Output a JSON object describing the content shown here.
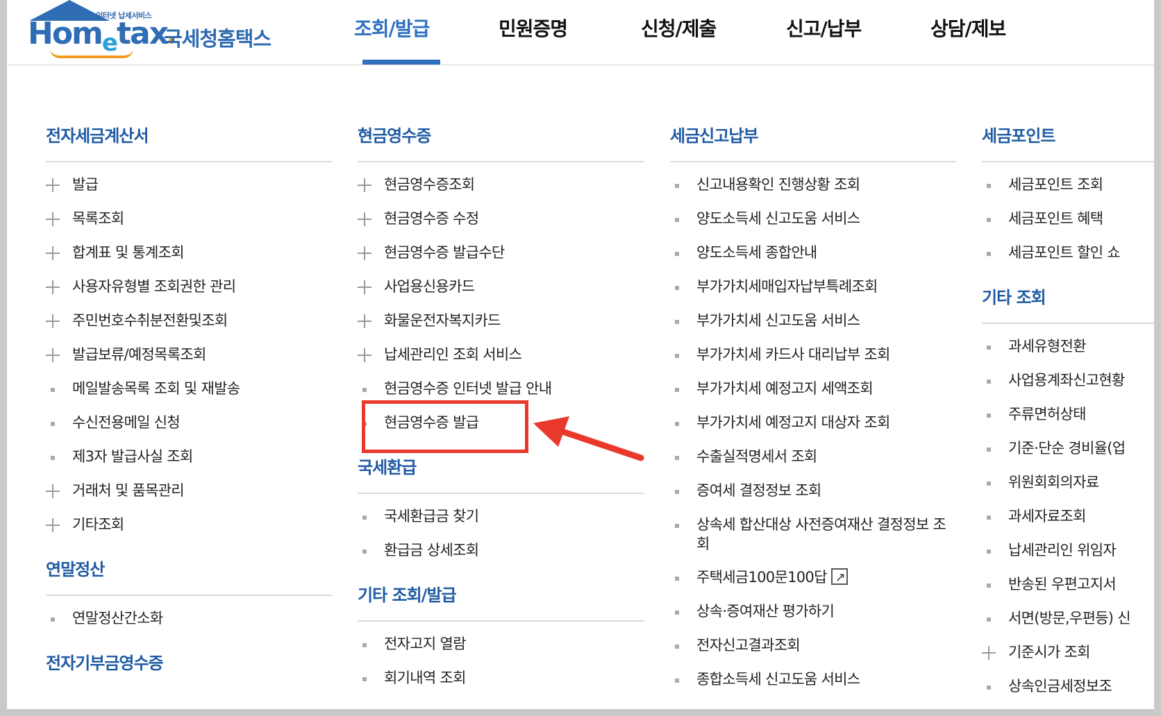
{
  "logo": {
    "small": "인터넷 납세서비스",
    "brand": "Hometax",
    "korean": "국세청홈택스"
  },
  "nav": [
    "조회/발급",
    "민원증명",
    "신청/제출",
    "신고/납부",
    "상담/제보"
  ],
  "col1": {
    "title": "전자세금계산서",
    "items": [
      {
        "label": "발급",
        "icon": "plus"
      },
      {
        "label": "목록조회",
        "icon": "plus"
      },
      {
        "label": "합계표 및 통계조회",
        "icon": "plus"
      },
      {
        "label": "사용자유형별 조회권한 관리",
        "icon": "plus"
      },
      {
        "label": "주민번호수취분전환및조회",
        "icon": "plus"
      },
      {
        "label": "발급보류/예정목록조회",
        "icon": "plus"
      },
      {
        "label": "메일발송목록 조회 및 재발송",
        "icon": "dot"
      },
      {
        "label": "수신전용메일 신청",
        "icon": "dot"
      },
      {
        "label": "제3자 발급사실 조회",
        "icon": "dot"
      },
      {
        "label": "거래처 및 품목관리",
        "icon": "plus"
      },
      {
        "label": "기타조회",
        "icon": "plus"
      }
    ],
    "title2": "연말정산",
    "items2": [
      {
        "label": "연말정산간소화",
        "icon": "dot"
      }
    ],
    "title3": "전자기부금영수증"
  },
  "col2": {
    "title": "현금영수증",
    "items": [
      {
        "label": "현금영수증조회",
        "icon": "plus"
      },
      {
        "label": "현금영수증 수정",
        "icon": "plus"
      },
      {
        "label": "현금영수증 발급수단",
        "icon": "plus"
      },
      {
        "label": "사업용신용카드",
        "icon": "plus"
      },
      {
        "label": "화물운전자복지카드",
        "icon": "plus"
      },
      {
        "label": "납세관리인 조회 서비스",
        "icon": "plus"
      },
      {
        "label": "현금영수증 인터넷 발급 안내",
        "icon": "dot"
      },
      {
        "label": "현금영수증 발급",
        "icon": "dot"
      }
    ],
    "title2": "국세환급",
    "items2": [
      {
        "label": "국세환급금 찾기",
        "icon": "dot"
      },
      {
        "label": "환급금 상세조회",
        "icon": "dot"
      }
    ],
    "title3": "기타 조회/발급",
    "items3": [
      {
        "label": "전자고지 열람",
        "icon": "dot"
      },
      {
        "label": "회기내역 조회",
        "icon": "dot"
      }
    ]
  },
  "col3": {
    "title": "세금신고납부",
    "items": [
      {
        "label": "신고내용확인 진행상황 조회",
        "icon": "dot"
      },
      {
        "label": "양도소득세 신고도움 서비스",
        "icon": "dot"
      },
      {
        "label": "양도소득세 종합안내",
        "icon": "dot"
      },
      {
        "label": "부가가치세매입자납부특례조회",
        "icon": "dot"
      },
      {
        "label": "부가가치세 신고도움 서비스",
        "icon": "dot"
      },
      {
        "label": "부가가치세 카드사 대리납부 조회",
        "icon": "dot"
      },
      {
        "label": "부가가치세 예정고지 세액조회",
        "icon": "dot"
      },
      {
        "label": "부가가치세 예정고지 대상자 조회",
        "icon": "dot"
      },
      {
        "label": "수출실적명세서 조회",
        "icon": "dot"
      },
      {
        "label": "증여세 결정정보 조회",
        "icon": "dot"
      },
      {
        "label": "상속세 합산대상 사전증여재산 결정정보 조회",
        "icon": "dot",
        "tall": true
      },
      {
        "label": "주택세금100문100답",
        "icon": "dot",
        "external": true
      },
      {
        "label": "상속·증여재산 평가하기",
        "icon": "dot"
      },
      {
        "label": "전자신고결과조회",
        "icon": "dot"
      },
      {
        "label": "종합소득세 신고도움 서비스",
        "icon": "dot"
      }
    ]
  },
  "col4": {
    "title": "세금포인트",
    "items": [
      {
        "label": "세금포인트 조회",
        "icon": "dot"
      },
      {
        "label": "세금포인트 혜택",
        "icon": "dot"
      },
      {
        "label": "세금포인트 할인 쇼",
        "icon": "dot"
      }
    ],
    "title2": "기타 조회",
    "items2": [
      {
        "label": "과세유형전환",
        "icon": "dot"
      },
      {
        "label": "사업용계좌신고현황",
        "icon": "dot"
      },
      {
        "label": "주류면허상태",
        "icon": "dot"
      },
      {
        "label": "기준·단순 경비율(업",
        "icon": "dot"
      },
      {
        "label": "위원회회의자료",
        "icon": "dot"
      },
      {
        "label": "과세자료조회",
        "icon": "dot"
      },
      {
        "label": "납세관리인 위임자",
        "icon": "dot"
      },
      {
        "label": "반송된 우편고지서",
        "icon": "dot"
      },
      {
        "label": "서면(방문,우편등) 신",
        "icon": "dot"
      },
      {
        "label": "기준시가 조회",
        "icon": "plus"
      },
      {
        "label": "상속인금세정보조",
        "icon": "dot"
      }
    ]
  },
  "colors": {
    "accent": "#2e6fc0",
    "highlight": "#e8392c"
  }
}
